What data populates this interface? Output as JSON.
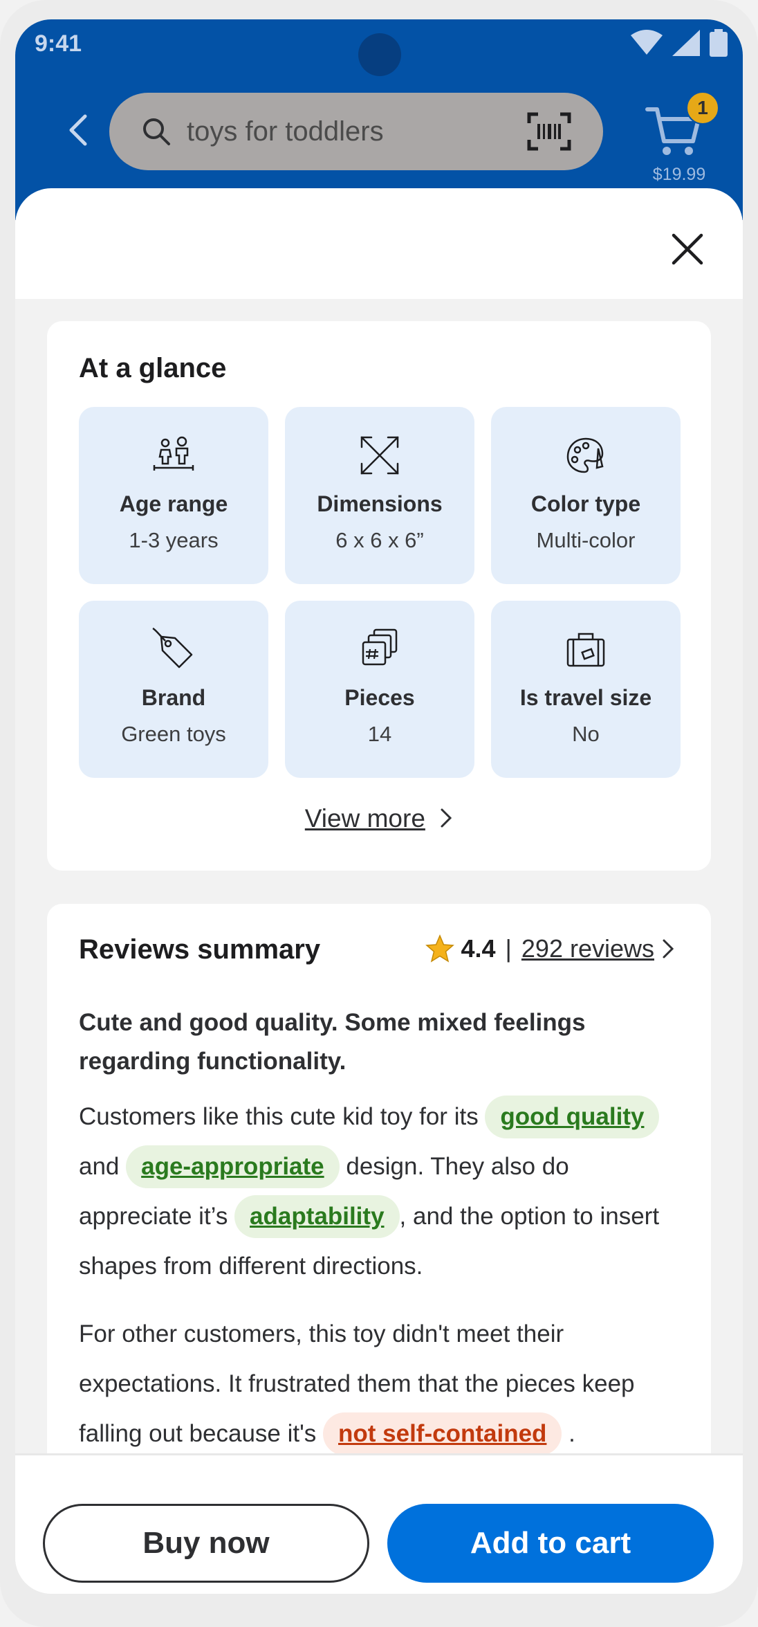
{
  "status_bar": {
    "time": "9:41"
  },
  "header": {
    "search_query": "toys for toddlers",
    "cart_count": "1",
    "cart_total": "$19.99"
  },
  "at_a_glance": {
    "title": "At a glance",
    "tiles": [
      {
        "icon": "age-range-icon",
        "label": "Age range",
        "value": "1-3 years"
      },
      {
        "icon": "dimensions-icon",
        "label": "Dimensions",
        "value": "6 x 6 x 6”"
      },
      {
        "icon": "palette-icon",
        "label": "Color type",
        "value": "Multi-color"
      },
      {
        "icon": "tag-icon",
        "label": "Brand",
        "value": "Green toys"
      },
      {
        "icon": "pieces-icon",
        "label": "Pieces",
        "value": "14"
      },
      {
        "icon": "suitcase-icon",
        "label": "Is travel size",
        "value": "No"
      }
    ],
    "view_more": "View more"
  },
  "reviews": {
    "title": "Reviews summary",
    "rating": "4.4",
    "separator": "|",
    "count_label": "292 reviews",
    "headline": "Cute and good quality. Some mixed feelings regarding functionality.",
    "p1": {
      "t1": "Customers like this cute kid toy for its ",
      "chip1": "good quality",
      "t2": " and ",
      "chip2": "age-appropriate",
      "t3": " design. They also do appreciate it’s ",
      "chip3": "adaptability",
      "t4": ", and the option to insert shapes from different directions."
    },
    "p2": {
      "t1": "For other customers, this toy didn't meet their expectations. It frustrated them that the pieces keep falling out because it's ",
      "chip1": "not self-contained",
      "t2": " ."
    }
  },
  "footer": {
    "buy_now": "Buy now",
    "add_to_cart": "Add to cart"
  },
  "colors": {
    "brand_blue": "#0352a6",
    "primary_button": "#0071dc",
    "tile_bg": "#e4eefa",
    "positive": "#2a7a1e",
    "negative": "#c23a0e"
  }
}
